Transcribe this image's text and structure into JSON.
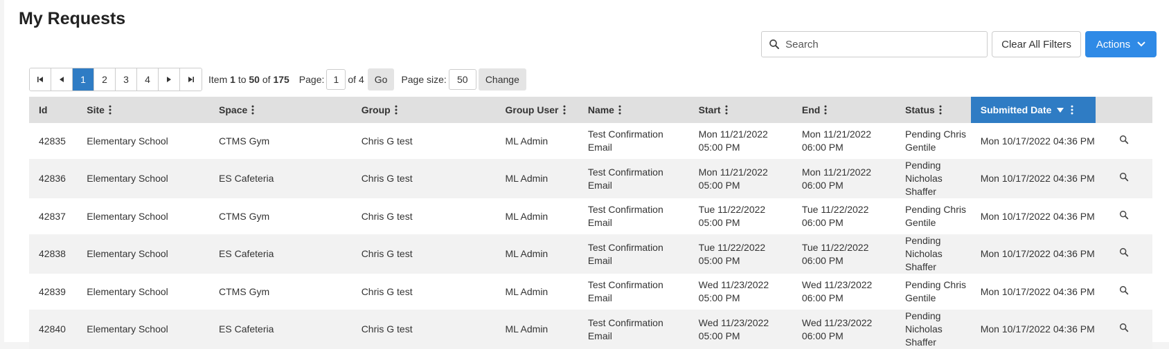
{
  "page": {
    "title": "My Requests"
  },
  "toolbar": {
    "search_placeholder": "Search",
    "search_value": "",
    "clear_label": "Clear All Filters",
    "actions_label": "Actions"
  },
  "pager": {
    "pages": [
      "1",
      "2",
      "3",
      "4"
    ],
    "current_page": "1",
    "item_prefix": "Item",
    "item_from": "1",
    "item_to_word": "to",
    "item_to": "50",
    "item_of_word": "of",
    "item_total": "175",
    "page_label": "Page:",
    "page_value": "1",
    "page_of": "of 4",
    "go_label": "Go",
    "size_label": "Page size:",
    "size_value": "50",
    "change_label": "Change"
  },
  "table": {
    "headers": [
      "Id",
      "Site",
      "Space",
      "Group",
      "Group User",
      "Name",
      "Start",
      "End",
      "Status",
      "Submitted Date"
    ],
    "rows": [
      {
        "id": "42835",
        "site": "Elementary School",
        "space": "CTMS Gym",
        "group": "Chris G test",
        "group_user": "ML Admin",
        "name": "Test Confirmation Email",
        "start": "Mon 11/21/2022 05:00 PM",
        "end": "Mon 11/21/2022 06:00 PM",
        "status": "Pending Chris Gentile",
        "submitted": "Mon 10/17/2022 04:36 PM"
      },
      {
        "id": "42836",
        "site": "Elementary School",
        "space": "ES Cafeteria",
        "group": "Chris G test",
        "group_user": "ML Admin",
        "name": "Test Confirmation Email",
        "start": "Mon 11/21/2022 05:00 PM",
        "end": "Mon 11/21/2022 06:00 PM",
        "status": "Pending Nicholas Shaffer",
        "submitted": "Mon 10/17/2022 04:36 PM"
      },
      {
        "id": "42837",
        "site": "Elementary School",
        "space": "CTMS Gym",
        "group": "Chris G test",
        "group_user": "ML Admin",
        "name": "Test Confirmation Email",
        "start": "Tue 11/22/2022 05:00 PM",
        "end": "Tue 11/22/2022 06:00 PM",
        "status": "Pending Chris Gentile",
        "submitted": "Mon 10/17/2022 04:36 PM"
      },
      {
        "id": "42838",
        "site": "Elementary School",
        "space": "ES Cafeteria",
        "group": "Chris G test",
        "group_user": "ML Admin",
        "name": "Test Confirmation Email",
        "start": "Tue 11/22/2022 05:00 PM",
        "end": "Tue 11/22/2022 06:00 PM",
        "status": "Pending Nicholas Shaffer",
        "submitted": "Mon 10/17/2022 04:36 PM"
      },
      {
        "id": "42839",
        "site": "Elementary School",
        "space": "CTMS Gym",
        "group": "Chris G test",
        "group_user": "ML Admin",
        "name": "Test Confirmation Email",
        "start": "Wed 11/23/2022 05:00 PM",
        "end": "Wed 11/23/2022 06:00 PM",
        "status": "Pending Chris Gentile",
        "submitted": "Mon 10/17/2022 04:36 PM"
      },
      {
        "id": "42840",
        "site": "Elementary School",
        "space": "ES Cafeteria",
        "group": "Chris G test",
        "group_user": "ML Admin",
        "name": "Test Confirmation Email",
        "start": "Wed 11/23/2022 05:00 PM",
        "end": "Wed 11/23/2022 06:00 PM",
        "status": "Pending Nicholas Shaffer",
        "submitted": "Mon 10/17/2022 04:36 PM"
      }
    ]
  },
  "colors": {
    "accent": "#2f8ae6",
    "sorted_header": "#2f7cc4",
    "header_bg": "#e0e0e0"
  },
  "icons": {
    "search": "search-icon",
    "view": "magnifier-icon",
    "sort": "sort-desc-icon",
    "menu": "kebab-icon"
  }
}
